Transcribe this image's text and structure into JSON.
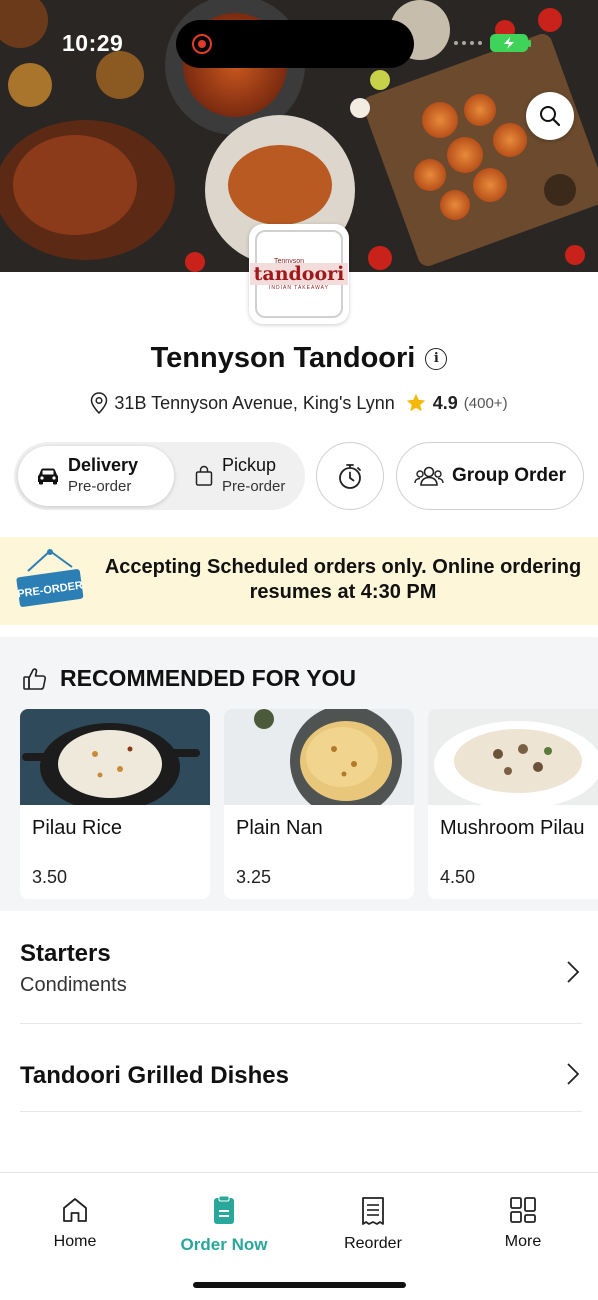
{
  "status_bar": {
    "time": "10:29"
  },
  "restaurant": {
    "name": "Tennyson Tandoori",
    "address": "31B Tennyson Avenue, King's Lynn",
    "rating": "4.9",
    "rating_count": "(400+)",
    "logo": {
      "small_text": "Tennyson",
      "name": "tandoori",
      "tagline": "INDIAN TAKEAWAY"
    }
  },
  "order_type": {
    "delivery": {
      "label": "Delivery",
      "sub": "Pre-order",
      "selected": true
    },
    "pickup": {
      "label": "Pickup",
      "sub": "Pre-order",
      "selected": false
    },
    "group_order_label": "Group Order"
  },
  "banner": {
    "sign_text": "PRE-ORDER",
    "message": "Accepting Scheduled orders only. Online ordering resumes at 4:30 PM"
  },
  "recommended": {
    "title": "RECOMMENDED FOR YOU",
    "items": [
      {
        "name": "Pilau Rice",
        "price": "3.50"
      },
      {
        "name": "Plain Nan",
        "price": "3.25"
      },
      {
        "name": "Mushroom Pilau",
        "price": "4.50"
      }
    ]
  },
  "menu_categories": [
    {
      "name": "Starters",
      "subtitle": "Condiments"
    },
    {
      "name": "Tandoori Grilled Dishes",
      "subtitle": ""
    }
  ],
  "bottom_nav": [
    {
      "label": "Home",
      "icon": "home-icon",
      "active": false
    },
    {
      "label": "Order Now",
      "icon": "order-icon",
      "active": true
    },
    {
      "label": "Reorder",
      "icon": "receipt-icon",
      "active": false
    },
    {
      "label": "More",
      "icon": "grid-icon",
      "active": false
    }
  ],
  "colors": {
    "accent": "#29a79a",
    "banner_bg": "#fdf6d8",
    "star": "#f5b800",
    "preorder_sign": "#2b7fb5"
  }
}
